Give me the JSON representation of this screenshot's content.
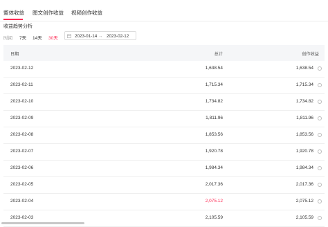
{
  "tabs": [
    {
      "label": "整体收益"
    },
    {
      "label": "图文创作收益"
    },
    {
      "label": "视频创作收益"
    }
  ],
  "section_title": "收益趋势分析",
  "filters": {
    "label": "时间",
    "options": [
      {
        "label": "7天"
      },
      {
        "label": "14天"
      },
      {
        "label": "30天",
        "selected": true
      }
    ]
  },
  "date_range": {
    "start": "2023-01-14",
    "separator": "→",
    "end": "2023-02-12"
  },
  "table": {
    "headers": [
      "日期",
      "总计",
      "创作收益"
    ],
    "rows": [
      {
        "date": "2023-02-12",
        "total": "1,638.54",
        "creation": "1,638.54"
      },
      {
        "date": "2023-02-11",
        "total": "1,715.34",
        "creation": "1,715.34"
      },
      {
        "date": "2023-02-10",
        "total": "1,734.82",
        "creation": "1,734.82"
      },
      {
        "date": "2023-02-09",
        "total": "1,811.96",
        "creation": "1,811.96"
      },
      {
        "date": "2023-02-08",
        "total": "1,853.56",
        "creation": "1,853.56"
      },
      {
        "date": "2023-02-07",
        "total": "1,920.78",
        "creation": "1,920.78"
      },
      {
        "date": "2023-02-06",
        "total": "1,984.34",
        "creation": "1,984.34"
      },
      {
        "date": "2023-02-05",
        "total": "2,017.36",
        "creation": "2,017.36"
      },
      {
        "date": "2023-02-04",
        "total": "2,075.12",
        "creation": "2,075.12",
        "total_highlight": true
      },
      {
        "date": "2023-02-03",
        "total": "2,105.59",
        "creation": "2,105.59"
      }
    ]
  },
  "colors": {
    "accent": "#fe2c55",
    "header_bg": "#f5f6f8",
    "muted": "#999999"
  },
  "icons": {
    "date_picker": "calendar-icon",
    "row_info": "info-icon"
  }
}
